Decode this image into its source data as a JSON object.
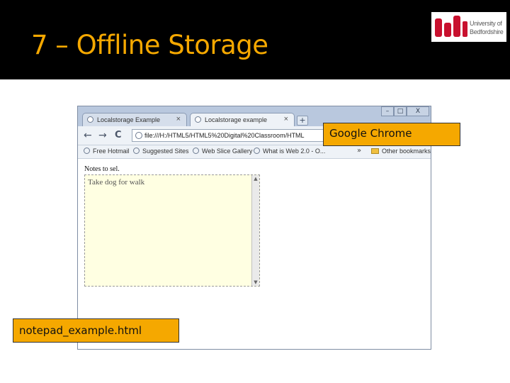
{
  "slide": {
    "title": "7 – Offline Storage",
    "colors": {
      "banner": "#000000",
      "title": "#f5a800",
      "callout": "#f5a800",
      "logo_red": "#c8102e"
    }
  },
  "logo": {
    "line1": "University of",
    "line2": "Bedfordshire"
  },
  "browser": {
    "tabs": [
      {
        "label": "Localstorage Example",
        "active": false,
        "close": "×"
      },
      {
        "label": "Localstorage example",
        "active": true,
        "close": "×"
      }
    ],
    "new_tab": "+",
    "window_controls": {
      "minimize": "–",
      "maximize": "□",
      "close": "X"
    },
    "nav": {
      "back": "←",
      "forward": "→",
      "reload": "C"
    },
    "address": "file:///H:/HTML5/HTML5%20Digital%20Classroom/HTML",
    "bookmarks": [
      {
        "label": "Free Hotmail",
        "icon": "page-icon"
      },
      {
        "label": "Suggested Sites",
        "icon": "page-icon"
      },
      {
        "label": "Web Slice Gallery",
        "icon": "page-icon"
      },
      {
        "label": "What is Web 2.0 - O...",
        "icon": "page-icon"
      }
    ],
    "bookmarks_overflow": "»",
    "other_bookmarks": "Other bookmarks"
  },
  "page": {
    "notes_label": "Notes to sel.",
    "textarea_value": "Take dog for walk"
  },
  "callouts": {
    "browser_name": "Google Chrome",
    "file_name": "notepad_example.html"
  }
}
